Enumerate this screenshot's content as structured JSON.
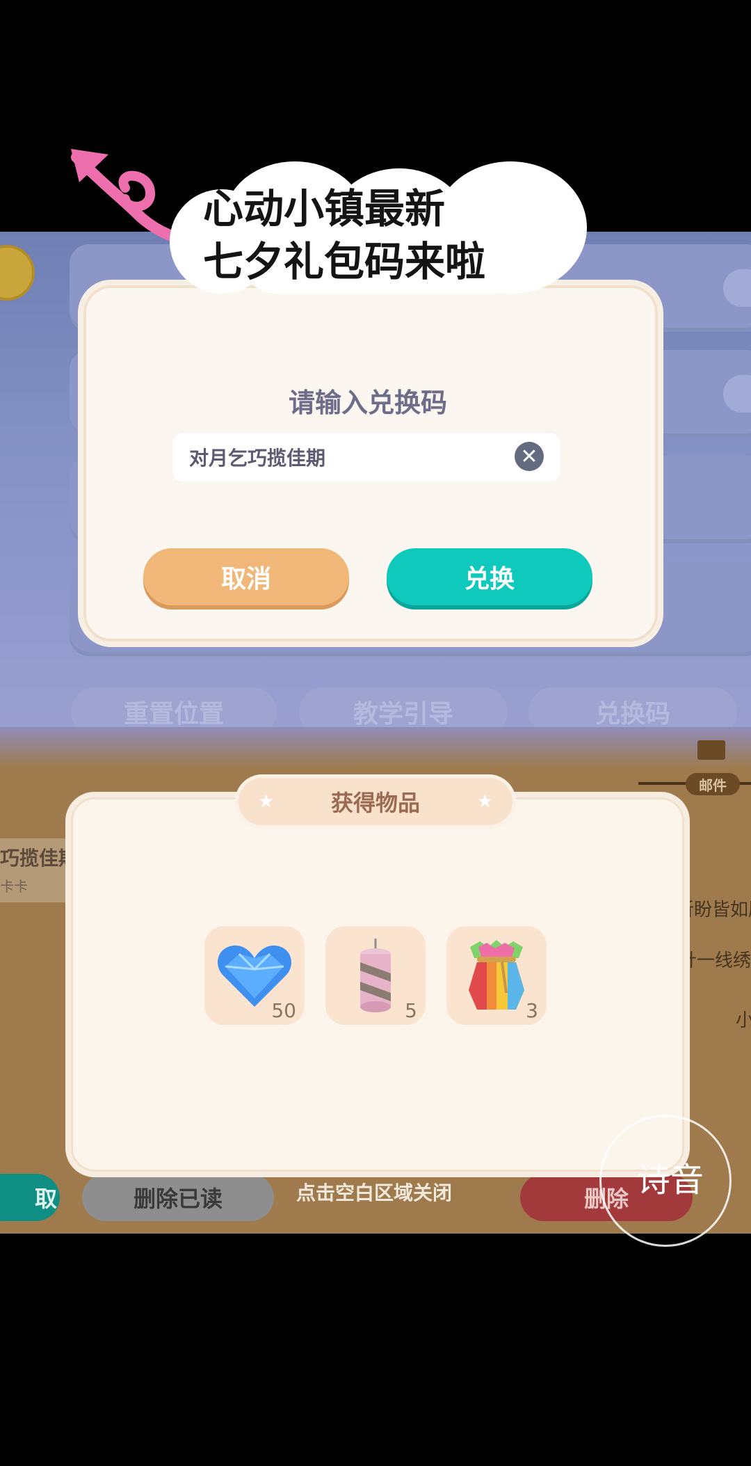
{
  "caption": {
    "line1": "心动小镇最新",
    "line2": "七夕礼包码来啦"
  },
  "redeem_dialog": {
    "title": "请输入兑换码",
    "code_value": "对月乞巧揽佳期",
    "cancel_label": "取消",
    "exchange_label": "兑换"
  },
  "background_top": {
    "buttons": [
      "重置位置",
      "教学引导",
      "兑换码"
    ]
  },
  "background_bottom": {
    "mail_label": "邮件",
    "mail_title": "巧揽佳期",
    "mail_sender": "卡卡",
    "right_texts": [
      "祈盼皆如愿",
      "针一线绣",
      "小"
    ],
    "claim_label": "取",
    "delete_read_label": "删除已读",
    "delete_label": "删除"
  },
  "reward_dialog": {
    "title": "获得物品",
    "items": [
      {
        "icon": "blue-heart-gem-icon",
        "count": "50"
      },
      {
        "icon": "firework-candle-icon",
        "count": "5"
      },
      {
        "icon": "rainbow-pouch-icon",
        "count": "3"
      }
    ],
    "close_hint": "点击空白区域关闭"
  },
  "watermark": {
    "text": "诗音"
  }
}
